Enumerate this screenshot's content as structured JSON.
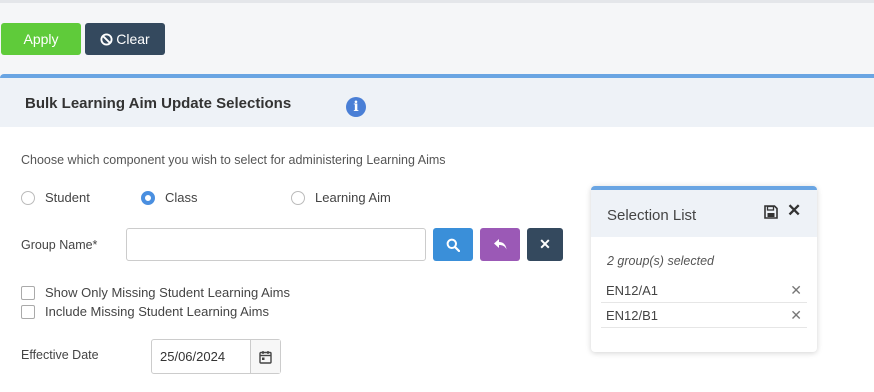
{
  "toolbar": {
    "apply_label": "Apply",
    "clear_label": "Clear"
  },
  "panel": {
    "title": "Bulk Learning Aim Update Selections",
    "instructions": "Choose which component you wish to select for administering Learning Aims",
    "radio_options": [
      {
        "label": "Student",
        "selected": false
      },
      {
        "label": "Class",
        "selected": true
      },
      {
        "label": "Learning Aim",
        "selected": false
      }
    ],
    "group_name_label": "Group Name*",
    "group_name_value": "",
    "checkboxes": [
      {
        "label": "Show Only Missing Student Learning Aims",
        "checked": false
      },
      {
        "label": "Include Missing Student Learning Aims",
        "checked": false
      }
    ],
    "effective_date_label": "Effective Date",
    "effective_date_value": "25/06/2024"
  },
  "selection_list": {
    "title": "Selection List",
    "count_text": "2 group(s) selected",
    "items": [
      "EN12/A1",
      "EN12/B1"
    ]
  },
  "colors": {
    "apply": "#5fcb3a",
    "dark": "#34495e",
    "accent": "#4a8fe0",
    "purple": "#9b59b6"
  }
}
